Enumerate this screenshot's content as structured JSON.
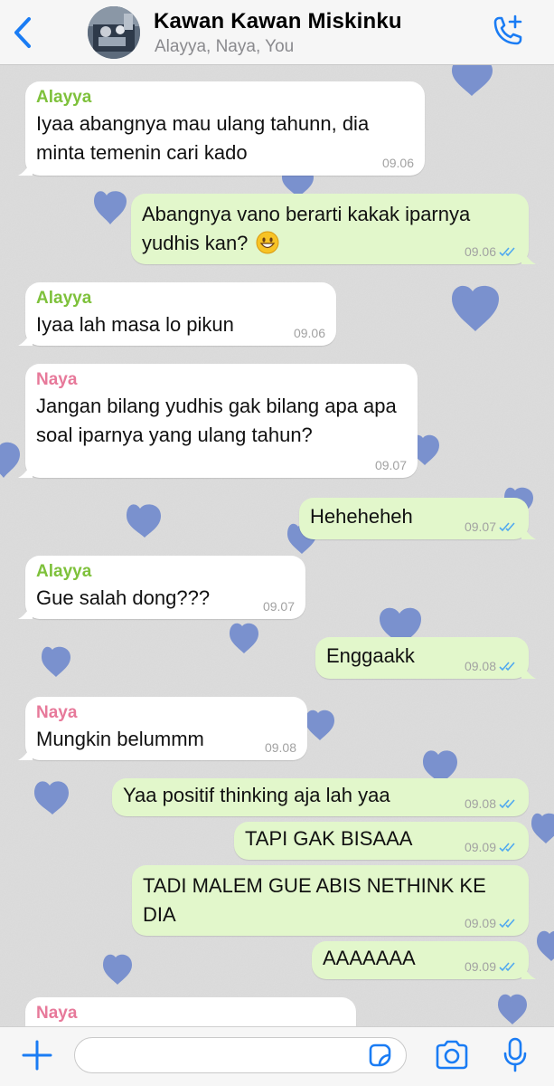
{
  "header": {
    "title": "Kawan Kawan Miskinku",
    "subtitle": "Alayya, Naya, You"
  },
  "colors": {
    "accent": "#1a7cf4",
    "sender_alayya": "#7ec13b",
    "sender_naya": "#e7799a",
    "incoming_bubble": "#ffffff",
    "outgoing_bubble": "#e2f7cb",
    "read_ticks": "#4fa8f0"
  },
  "messages": [
    {
      "sender": "Alayya",
      "text": "Iyaa abangnya mau ulang tahunn, dia minta temenin cari kado",
      "time": "09.06"
    },
    {
      "text": "Abangnya vano berarti kakak iparnya yudhis kan?",
      "emoji": "grinning-face-emoji",
      "time": "09.06"
    },
    {
      "sender": "Alayya",
      "text": "Iyaa lah masa lo pikun",
      "time": "09.06"
    },
    {
      "sender": "Naya",
      "text": "Jangan bilang yudhis gak bilang apa apa soal iparnya yang ulang tahun?",
      "time": "09.07"
    },
    {
      "text": "Heheheheh",
      "time": "09.07"
    },
    {
      "sender": "Alayya",
      "text": "Gue salah dong???",
      "time": "09.07"
    },
    {
      "text": "Enggaakk",
      "time": "09.08"
    },
    {
      "sender": "Naya",
      "text": "Mungkin belummm",
      "time": "09.08"
    },
    {
      "text": "Yaa positif thinking aja lah yaa",
      "time": "09.08"
    },
    {
      "text": "TAPI GAK BISAAA",
      "time": "09.09"
    },
    {
      "text": "TADI MALEM GUE ABIS NETHINK KE DIA",
      "time": "09.09"
    },
    {
      "text": "AAAAAAA",
      "time": "09.09"
    },
    {
      "sender": "Naya"
    }
  ],
  "icons": {
    "back": "chevron-left-icon",
    "call": "add-call-icon",
    "plus": "plus-icon",
    "sticker": "sticker-icon",
    "camera": "camera-icon",
    "mic": "microphone-icon"
  },
  "composer": {
    "value": ""
  }
}
